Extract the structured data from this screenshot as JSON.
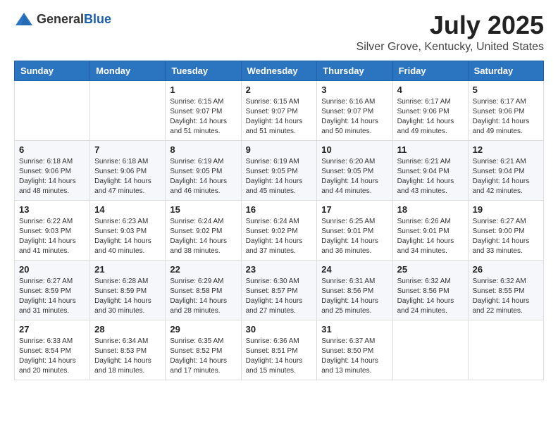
{
  "logo": {
    "general": "General",
    "blue": "Blue"
  },
  "header": {
    "title": "July 2025",
    "subtitle": "Silver Grove, Kentucky, United States"
  },
  "calendar": {
    "weekdays": [
      "Sunday",
      "Monday",
      "Tuesday",
      "Wednesday",
      "Thursday",
      "Friday",
      "Saturday"
    ],
    "weeks": [
      [
        {
          "day": "",
          "info": ""
        },
        {
          "day": "",
          "info": ""
        },
        {
          "day": "1",
          "info": "Sunrise: 6:15 AM\nSunset: 9:07 PM\nDaylight: 14 hours and 51 minutes."
        },
        {
          "day": "2",
          "info": "Sunrise: 6:15 AM\nSunset: 9:07 PM\nDaylight: 14 hours and 51 minutes."
        },
        {
          "day": "3",
          "info": "Sunrise: 6:16 AM\nSunset: 9:07 PM\nDaylight: 14 hours and 50 minutes."
        },
        {
          "day": "4",
          "info": "Sunrise: 6:17 AM\nSunset: 9:06 PM\nDaylight: 14 hours and 49 minutes."
        },
        {
          "day": "5",
          "info": "Sunrise: 6:17 AM\nSunset: 9:06 PM\nDaylight: 14 hours and 49 minutes."
        }
      ],
      [
        {
          "day": "6",
          "info": "Sunrise: 6:18 AM\nSunset: 9:06 PM\nDaylight: 14 hours and 48 minutes."
        },
        {
          "day": "7",
          "info": "Sunrise: 6:18 AM\nSunset: 9:06 PM\nDaylight: 14 hours and 47 minutes."
        },
        {
          "day": "8",
          "info": "Sunrise: 6:19 AM\nSunset: 9:05 PM\nDaylight: 14 hours and 46 minutes."
        },
        {
          "day": "9",
          "info": "Sunrise: 6:19 AM\nSunset: 9:05 PM\nDaylight: 14 hours and 45 minutes."
        },
        {
          "day": "10",
          "info": "Sunrise: 6:20 AM\nSunset: 9:05 PM\nDaylight: 14 hours and 44 minutes."
        },
        {
          "day": "11",
          "info": "Sunrise: 6:21 AM\nSunset: 9:04 PM\nDaylight: 14 hours and 43 minutes."
        },
        {
          "day": "12",
          "info": "Sunrise: 6:21 AM\nSunset: 9:04 PM\nDaylight: 14 hours and 42 minutes."
        }
      ],
      [
        {
          "day": "13",
          "info": "Sunrise: 6:22 AM\nSunset: 9:03 PM\nDaylight: 14 hours and 41 minutes."
        },
        {
          "day": "14",
          "info": "Sunrise: 6:23 AM\nSunset: 9:03 PM\nDaylight: 14 hours and 40 minutes."
        },
        {
          "day": "15",
          "info": "Sunrise: 6:24 AM\nSunset: 9:02 PM\nDaylight: 14 hours and 38 minutes."
        },
        {
          "day": "16",
          "info": "Sunrise: 6:24 AM\nSunset: 9:02 PM\nDaylight: 14 hours and 37 minutes."
        },
        {
          "day": "17",
          "info": "Sunrise: 6:25 AM\nSunset: 9:01 PM\nDaylight: 14 hours and 36 minutes."
        },
        {
          "day": "18",
          "info": "Sunrise: 6:26 AM\nSunset: 9:01 PM\nDaylight: 14 hours and 34 minutes."
        },
        {
          "day": "19",
          "info": "Sunrise: 6:27 AM\nSunset: 9:00 PM\nDaylight: 14 hours and 33 minutes."
        }
      ],
      [
        {
          "day": "20",
          "info": "Sunrise: 6:27 AM\nSunset: 8:59 PM\nDaylight: 14 hours and 31 minutes."
        },
        {
          "day": "21",
          "info": "Sunrise: 6:28 AM\nSunset: 8:59 PM\nDaylight: 14 hours and 30 minutes."
        },
        {
          "day": "22",
          "info": "Sunrise: 6:29 AM\nSunset: 8:58 PM\nDaylight: 14 hours and 28 minutes."
        },
        {
          "day": "23",
          "info": "Sunrise: 6:30 AM\nSunset: 8:57 PM\nDaylight: 14 hours and 27 minutes."
        },
        {
          "day": "24",
          "info": "Sunrise: 6:31 AM\nSunset: 8:56 PM\nDaylight: 14 hours and 25 minutes."
        },
        {
          "day": "25",
          "info": "Sunrise: 6:32 AM\nSunset: 8:56 PM\nDaylight: 14 hours and 24 minutes."
        },
        {
          "day": "26",
          "info": "Sunrise: 6:32 AM\nSunset: 8:55 PM\nDaylight: 14 hours and 22 minutes."
        }
      ],
      [
        {
          "day": "27",
          "info": "Sunrise: 6:33 AM\nSunset: 8:54 PM\nDaylight: 14 hours and 20 minutes."
        },
        {
          "day": "28",
          "info": "Sunrise: 6:34 AM\nSunset: 8:53 PM\nDaylight: 14 hours and 18 minutes."
        },
        {
          "day": "29",
          "info": "Sunrise: 6:35 AM\nSunset: 8:52 PM\nDaylight: 14 hours and 17 minutes."
        },
        {
          "day": "30",
          "info": "Sunrise: 6:36 AM\nSunset: 8:51 PM\nDaylight: 14 hours and 15 minutes."
        },
        {
          "day": "31",
          "info": "Sunrise: 6:37 AM\nSunset: 8:50 PM\nDaylight: 14 hours and 13 minutes."
        },
        {
          "day": "",
          "info": ""
        },
        {
          "day": "",
          "info": ""
        }
      ]
    ]
  }
}
